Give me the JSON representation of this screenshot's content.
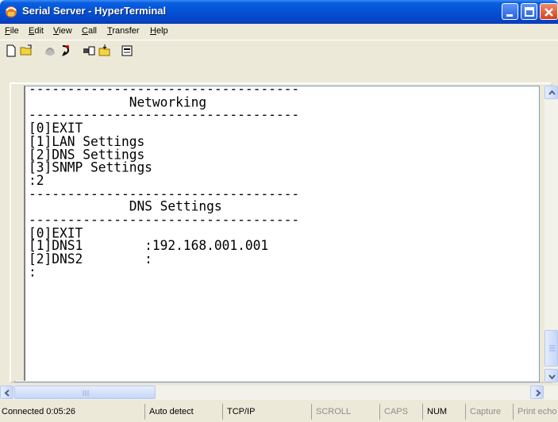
{
  "window": {
    "title": "Serial Server - HyperTerminal"
  },
  "menu": [
    "File",
    "Edit",
    "View",
    "Call",
    "Transfer",
    "Help"
  ],
  "menu_underline": [
    "F",
    "E",
    "V",
    "C",
    "T",
    "H"
  ],
  "toolbar": [
    "new-document-icon",
    "open-folder-icon",
    "disconnect-icon",
    "dial-icon",
    "send-icon",
    "receive-icon",
    "properties-icon"
  ],
  "terminal": {
    "lines": [
      "-----------------------------------",
      "             Networking",
      "-----------------------------------",
      "[0]EXIT",
      "[1]LAN Settings",
      "[2]DNS Settings",
      "[3]SNMP Settings",
      ":2",
      "-----------------------------------",
      "             DNS Settings",
      "-----------------------------------",
      "[0]EXIT",
      "[1]DNS1        :192.168.001.001",
      "[2]DNS2        :",
      ":"
    ]
  },
  "status": {
    "connected": "Connected 0:05:26",
    "detect": "Auto detect",
    "protocol": "TCP/IP",
    "scroll": "SCROLL",
    "caps": "CAPS",
    "num": "NUM",
    "capture": "Capture",
    "print": "Print echo"
  }
}
